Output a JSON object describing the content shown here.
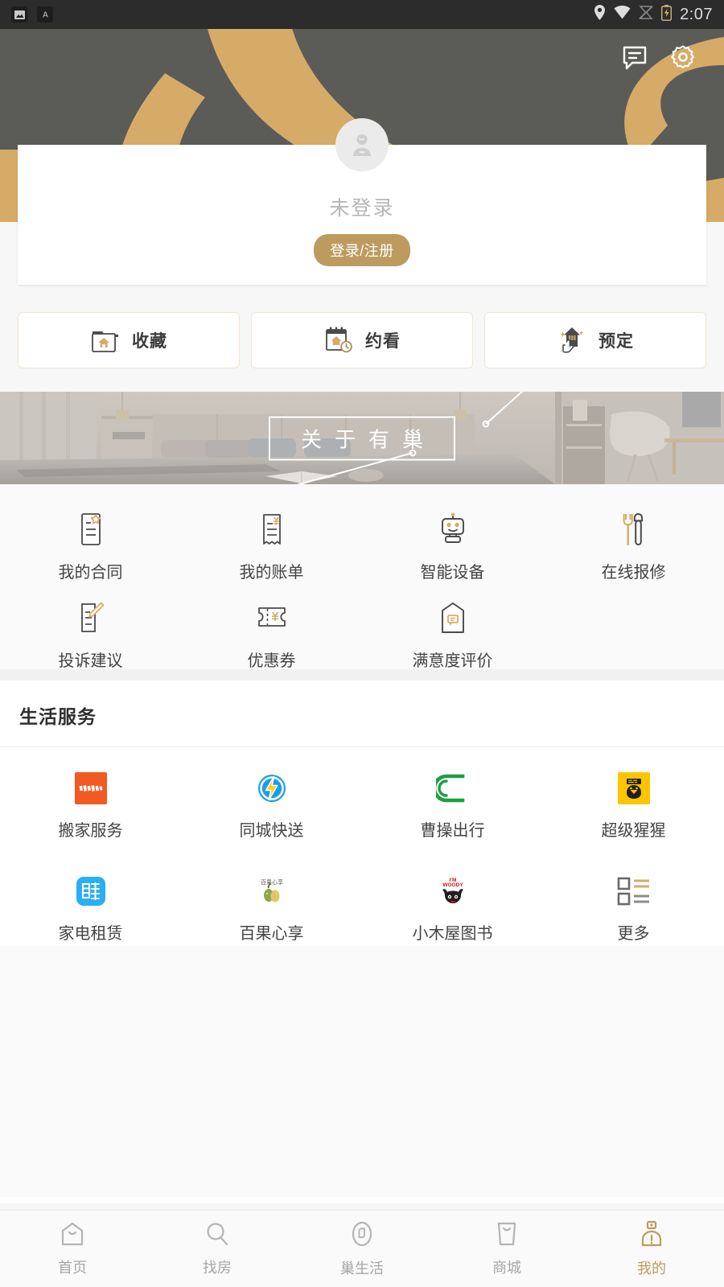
{
  "statusbar": {
    "time": "2:07",
    "left_icons": [
      "photo-icon",
      "font-icon"
    ],
    "right_icons": [
      "location-icon",
      "wifi-icon",
      "signal-off-icon",
      "battery-charging-icon"
    ]
  },
  "colors": {
    "accent_gold": "#bd9b5f",
    "hero_bg": "#5b5b57",
    "hero_swoosh": "#d6ab68",
    "page_bg": "#fafafa",
    "text_primary": "#3b3b3b",
    "text_muted": "#a6a6a6"
  },
  "hero": {
    "message_icon": "message-icon",
    "settings_icon": "gear-icon"
  },
  "profile": {
    "avatar_icon": "user-avatar-icon",
    "nickname": "未登录",
    "login_label": "登录/注册"
  },
  "quick_actions": [
    {
      "label": "收藏",
      "icon": "folder-house-icon"
    },
    {
      "label": "约看",
      "icon": "calendar-house-clock-icon"
    },
    {
      "label": "预定",
      "icon": "house-hand-tap-icon"
    }
  ],
  "banner": {
    "text": "关于有巢",
    "alt": "bedroom-interior-photo"
  },
  "services": [
    {
      "label": "我的合同",
      "icon": "contract-star-icon"
    },
    {
      "label": "我的账单",
      "icon": "bill-yuan-icon"
    },
    {
      "label": "智能设备",
      "icon": "robot-icon"
    },
    {
      "label": "在线报修",
      "icon": "wrench-screwdriver-icon"
    },
    {
      "label": "投诉建议",
      "icon": "feedback-pencil-icon"
    },
    {
      "label": "优惠券",
      "icon": "coupon-yuan-icon"
    },
    {
      "label": "满意度评价",
      "icon": "satisfaction-house-icon"
    }
  ],
  "life": {
    "title": "生活服务",
    "items": [
      {
        "label": "搬家服务",
        "icon": "lalahu-logo",
        "color": "#f15a22"
      },
      {
        "label": "同城快送",
        "icon": "shansong-lightning-logo",
        "color": "#1b9cf0"
      },
      {
        "label": "曹操出行",
        "icon": "caocao-c-logo",
        "color": "#1aa041"
      },
      {
        "label": "超级猩猩",
        "icon": "supermonkey-logo",
        "color": "#fdc500"
      },
      {
        "label": "家电租赁",
        "icon": "zu-rent-logo",
        "color": "#2aaef5"
      },
      {
        "label": "百果心享",
        "icon": "baiguo-fruit-logo",
        "color": "#8aa84b"
      },
      {
        "label": "小木屋图书",
        "icon": "woody-books-logo",
        "color": "#c31b24"
      },
      {
        "label": "更多",
        "icon": "more-list-icon",
        "color": "#6b6b6b"
      }
    ]
  },
  "tabbar": {
    "items": [
      {
        "label": "首页",
        "icon": "home-icon",
        "active": false
      },
      {
        "label": "找房",
        "icon": "search-icon",
        "active": false
      },
      {
        "label": "巢生活",
        "icon": "nest-life-icon",
        "active": false
      },
      {
        "label": "商城",
        "icon": "shop-bag-icon",
        "active": false
      },
      {
        "label": "我的",
        "icon": "profile-icon",
        "active": true
      }
    ]
  }
}
